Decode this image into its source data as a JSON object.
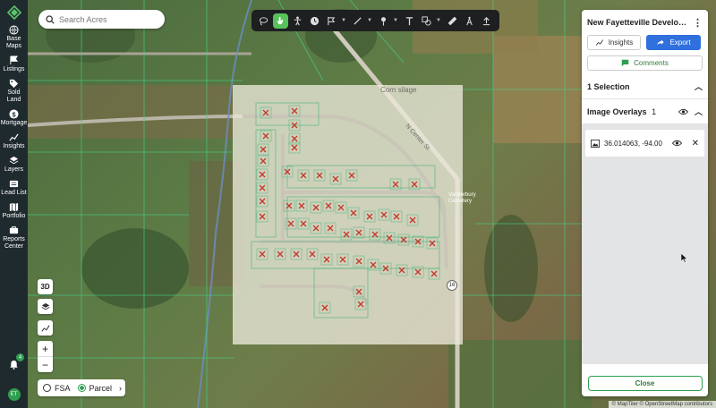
{
  "rail": {
    "items": [
      {
        "label": "Base Maps",
        "icon": "globe-icon"
      },
      {
        "label": "Listings",
        "icon": "flag-icon"
      },
      {
        "label": "Sold Land",
        "icon": "tag-icon"
      },
      {
        "label": "Mortgage",
        "icon": "dollar-icon"
      },
      {
        "label": "Insights",
        "icon": "chart-icon"
      },
      {
        "label": "Layers",
        "icon": "layers-icon"
      },
      {
        "label": "Lead List",
        "icon": "list-icon"
      },
      {
        "label": "Portfolio",
        "icon": "map-icon"
      },
      {
        "label": "Reports Center",
        "icon": "briefcase-icon"
      }
    ],
    "notifications": "4",
    "avatar": "ET"
  },
  "search": {
    "placeholder": "Search Acres"
  },
  "map": {
    "labels": {
      "corn": "Corn silage",
      "street": "N Center St",
      "cemetery": "Vanderbury Cemetery",
      "route": "16"
    },
    "controls": {
      "view3d": "3D",
      "zoom_in": "+",
      "zoom_out": "−"
    },
    "layer_toggle": {
      "fsa": "FSA",
      "parcel": "Parcel",
      "selected": "Parcel"
    },
    "attribution": "© MapTiler © OpenStreetMap contributors"
  },
  "panel": {
    "title": "New Fayetteville Develop...",
    "insights_label": "Insights",
    "export_label": "Export",
    "comments_label": "Comments",
    "selection_label": "1 Selection",
    "overlays_label": "Image Overlays",
    "overlays_count": "1",
    "overlay_item": "36.014063, -94.00",
    "close_label": "Close"
  },
  "colors": {
    "accent": "#58c25a",
    "blue": "#2f6fde",
    "rail": "#1f2a2e",
    "parcel_line": "#46d08a",
    "marker": "#c0392b"
  }
}
